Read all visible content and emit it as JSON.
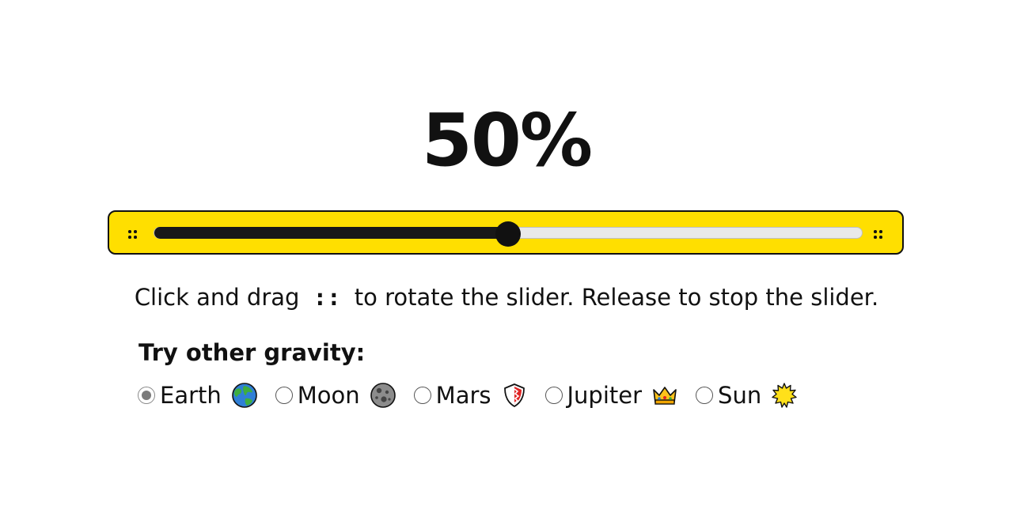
{
  "slider": {
    "percent_text": "50%",
    "value_fraction": 0.5,
    "frame_color": "#ffdf00",
    "track_color": "#e9e9e9",
    "fill_color": "#181818"
  },
  "instructions": {
    "before": "Click and drag",
    "handle_glyph": "::",
    "after": "to rotate the slider. Release to stop the slider."
  },
  "gravity": {
    "heading": "Try other gravity:",
    "selected": "Earth",
    "options": [
      {
        "label": "Earth",
        "icon": "globe-icon",
        "checked": true
      },
      {
        "label": "Moon",
        "icon": "moon-icon",
        "checked": false
      },
      {
        "label": "Mars",
        "icon": "shield-icon",
        "checked": false
      },
      {
        "label": "Jupiter",
        "icon": "crown-icon",
        "checked": false
      },
      {
        "label": "Sun",
        "icon": "sun-icon",
        "checked": false
      }
    ]
  }
}
